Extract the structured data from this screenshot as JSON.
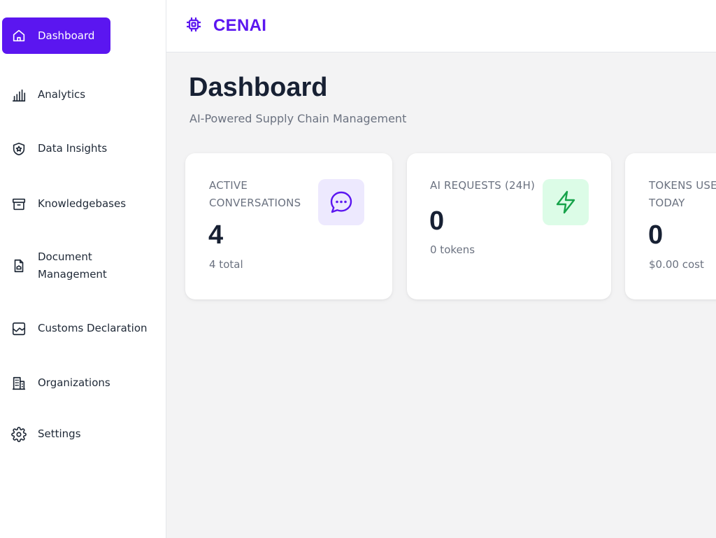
{
  "brand": {
    "name": "CENAI",
    "icon": "chip-icon",
    "color": "#5b16f0"
  },
  "sidebar": {
    "items": [
      {
        "label": "Dashboard",
        "icon": "home-icon",
        "active": true
      },
      {
        "label": "Analytics",
        "icon": "bar-chart-icon"
      },
      {
        "label": "Data Insights",
        "icon": "shield-star-icon"
      },
      {
        "label": "Knowledgebases",
        "icon": "archive-box-icon"
      },
      {
        "label_line1": "Document",
        "label_line2": "Management",
        "icon": "document-icon"
      },
      {
        "label": "Customs Declaration",
        "icon": "inbox-chart-icon"
      },
      {
        "label": "Organizations",
        "icon": "building-icon"
      },
      {
        "label": "Settings",
        "icon": "gear-icon"
      }
    ]
  },
  "page": {
    "title": "Dashboard",
    "subtitle": "AI-Powered Supply Chain Management"
  },
  "cards": [
    {
      "label_line1": "ACTIVE",
      "label_line2": "CONVERSATIONS",
      "value": "4",
      "sub": "4 total",
      "icon": "chat-bubble-icon",
      "icon_bg": "#ede9fe",
      "icon_color": "#5b16f0"
    },
    {
      "label_line1": "AI REQUESTS (24H)",
      "value": "0",
      "sub": "0 tokens",
      "icon": "lightning-icon",
      "icon_bg": "#dcfce7",
      "icon_color": "#16a34a"
    },
    {
      "label_line1": "TOKENS USE",
      "label_line2": "TODAY",
      "value": "0",
      "sub": "$0.00 cost"
    }
  ]
}
